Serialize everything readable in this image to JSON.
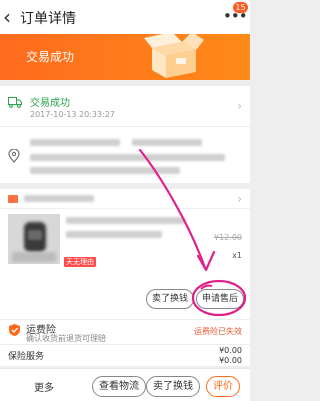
{
  "header": {
    "title": "订单详情",
    "message_count": "15"
  },
  "banner": {
    "text": "交易成功"
  },
  "status": {
    "text": "交易成功",
    "time": "2017-10-13 20:33:27"
  },
  "product": {
    "price": "¥12.00",
    "qty": "x1",
    "tag": "天无理由"
  },
  "item_actions": {
    "exchange": "卖了换钱",
    "after_sale": "申请售后"
  },
  "insurance": {
    "title": "运费险",
    "subtitle": "确认收货前退货可理赔",
    "status": "运费险已失效"
  },
  "service": {
    "label": "保险服务",
    "amount": "¥0.00",
    "amount2": "¥0.00"
  },
  "actions": {
    "more": "更多",
    "logistics": "查看物流",
    "exchange": "卖了换钱",
    "review": "评价"
  },
  "colors": {
    "accent": "#ff6a1a",
    "success": "#2ba24c",
    "annotation": "#e0218a"
  }
}
